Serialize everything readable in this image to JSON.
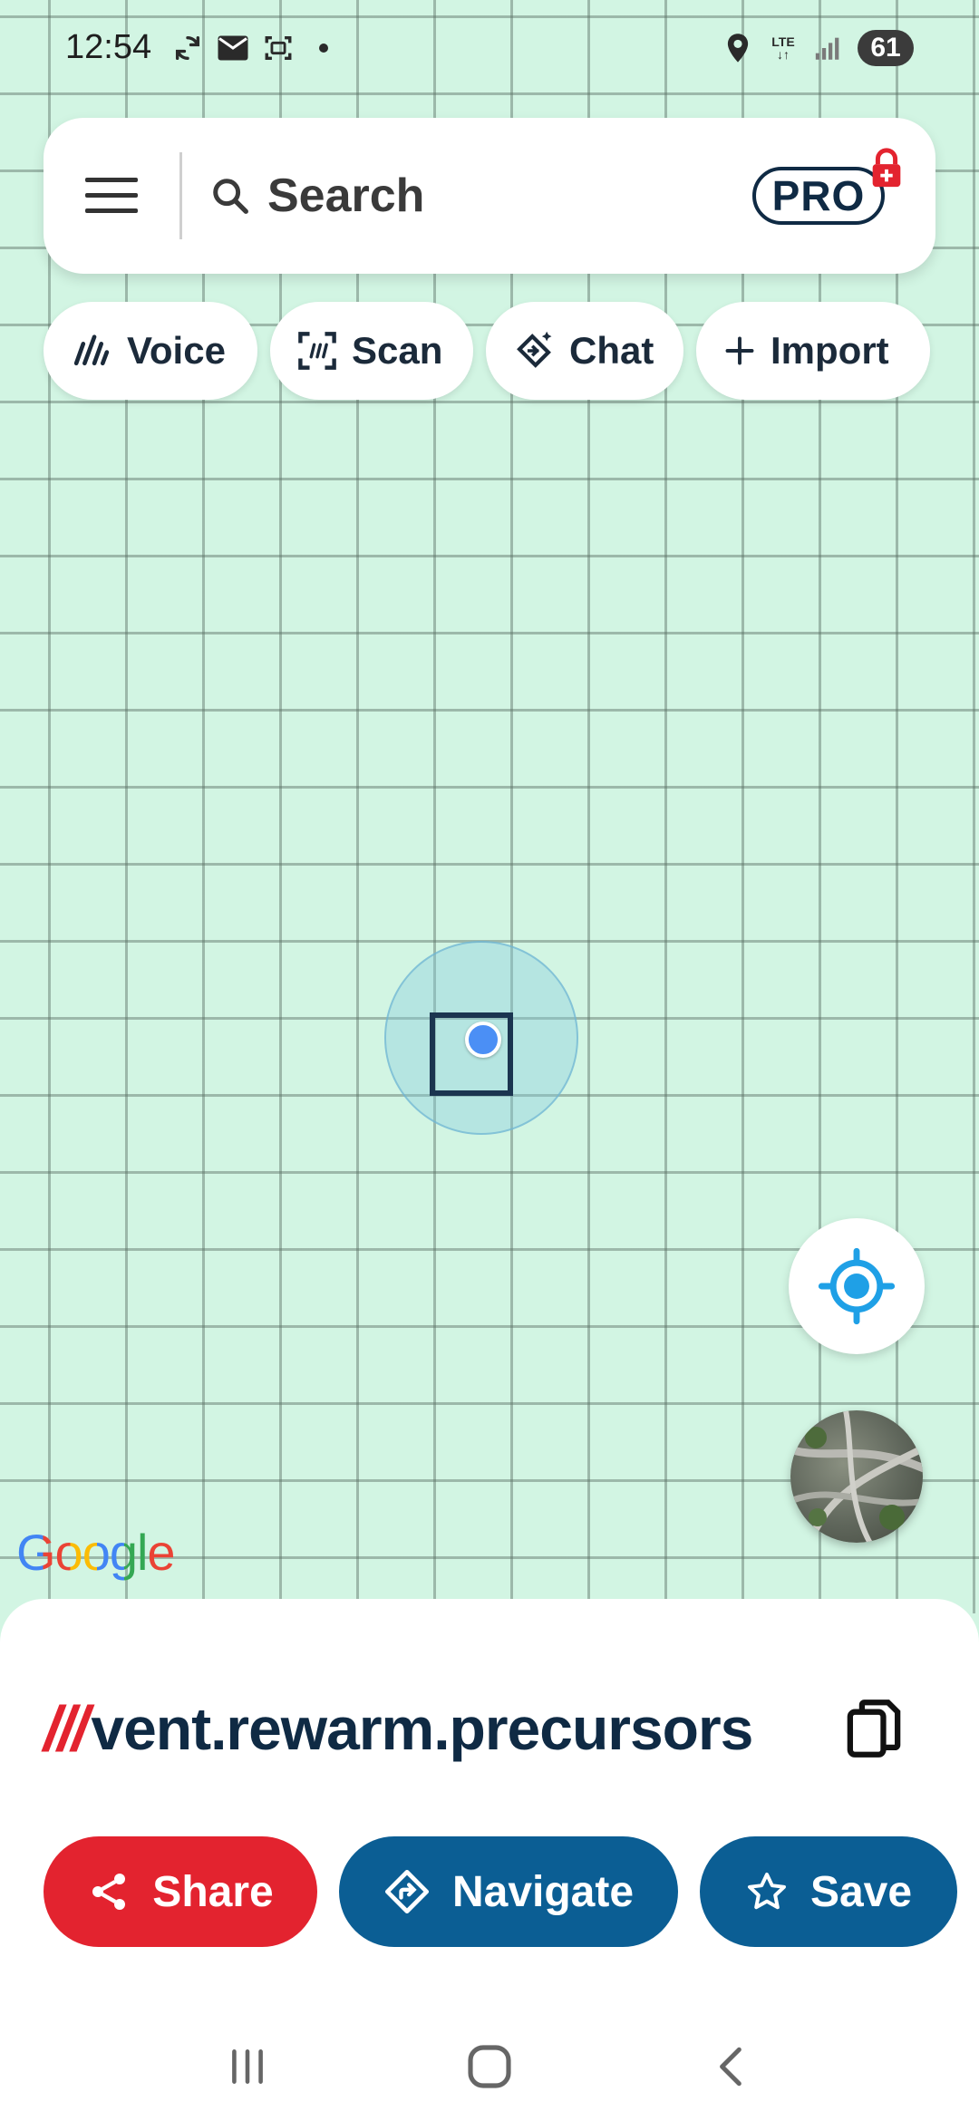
{
  "status_bar": {
    "time": "12:54",
    "network": "LTE",
    "battery": "61",
    "icons_left": [
      "sync-icon",
      "mail-icon",
      "screenshot-icon",
      "dot-icon"
    ],
    "icons_right": [
      "location-icon",
      "lte-icon",
      "signal-icon"
    ]
  },
  "search": {
    "placeholder": "Search",
    "pro_label": "PRO"
  },
  "chips": [
    {
      "label": "Voice",
      "icon": "voice-icon"
    },
    {
      "label": "Scan",
      "icon": "scan-icon"
    },
    {
      "label": "Chat",
      "icon": "chat-icon"
    },
    {
      "label": "Import",
      "icon": "plus-icon"
    }
  ],
  "map": {
    "attribution": "Google"
  },
  "sheet": {
    "slashes": "///",
    "address": "vent.rewarm.precursors",
    "actions": [
      {
        "label": "Share",
        "icon": "share-icon",
        "color": "#e3232f"
      },
      {
        "label": "Navigate",
        "icon": "navigate-icon",
        "color": "#0b5e94"
      },
      {
        "label": "Save",
        "icon": "star-icon",
        "color": "#0b5e94"
      }
    ]
  },
  "colors": {
    "accent_red": "#e3232f",
    "brand_navy": "#0f2a44",
    "button_blue": "#0b5e94",
    "map_background": "#d2f5e3"
  }
}
